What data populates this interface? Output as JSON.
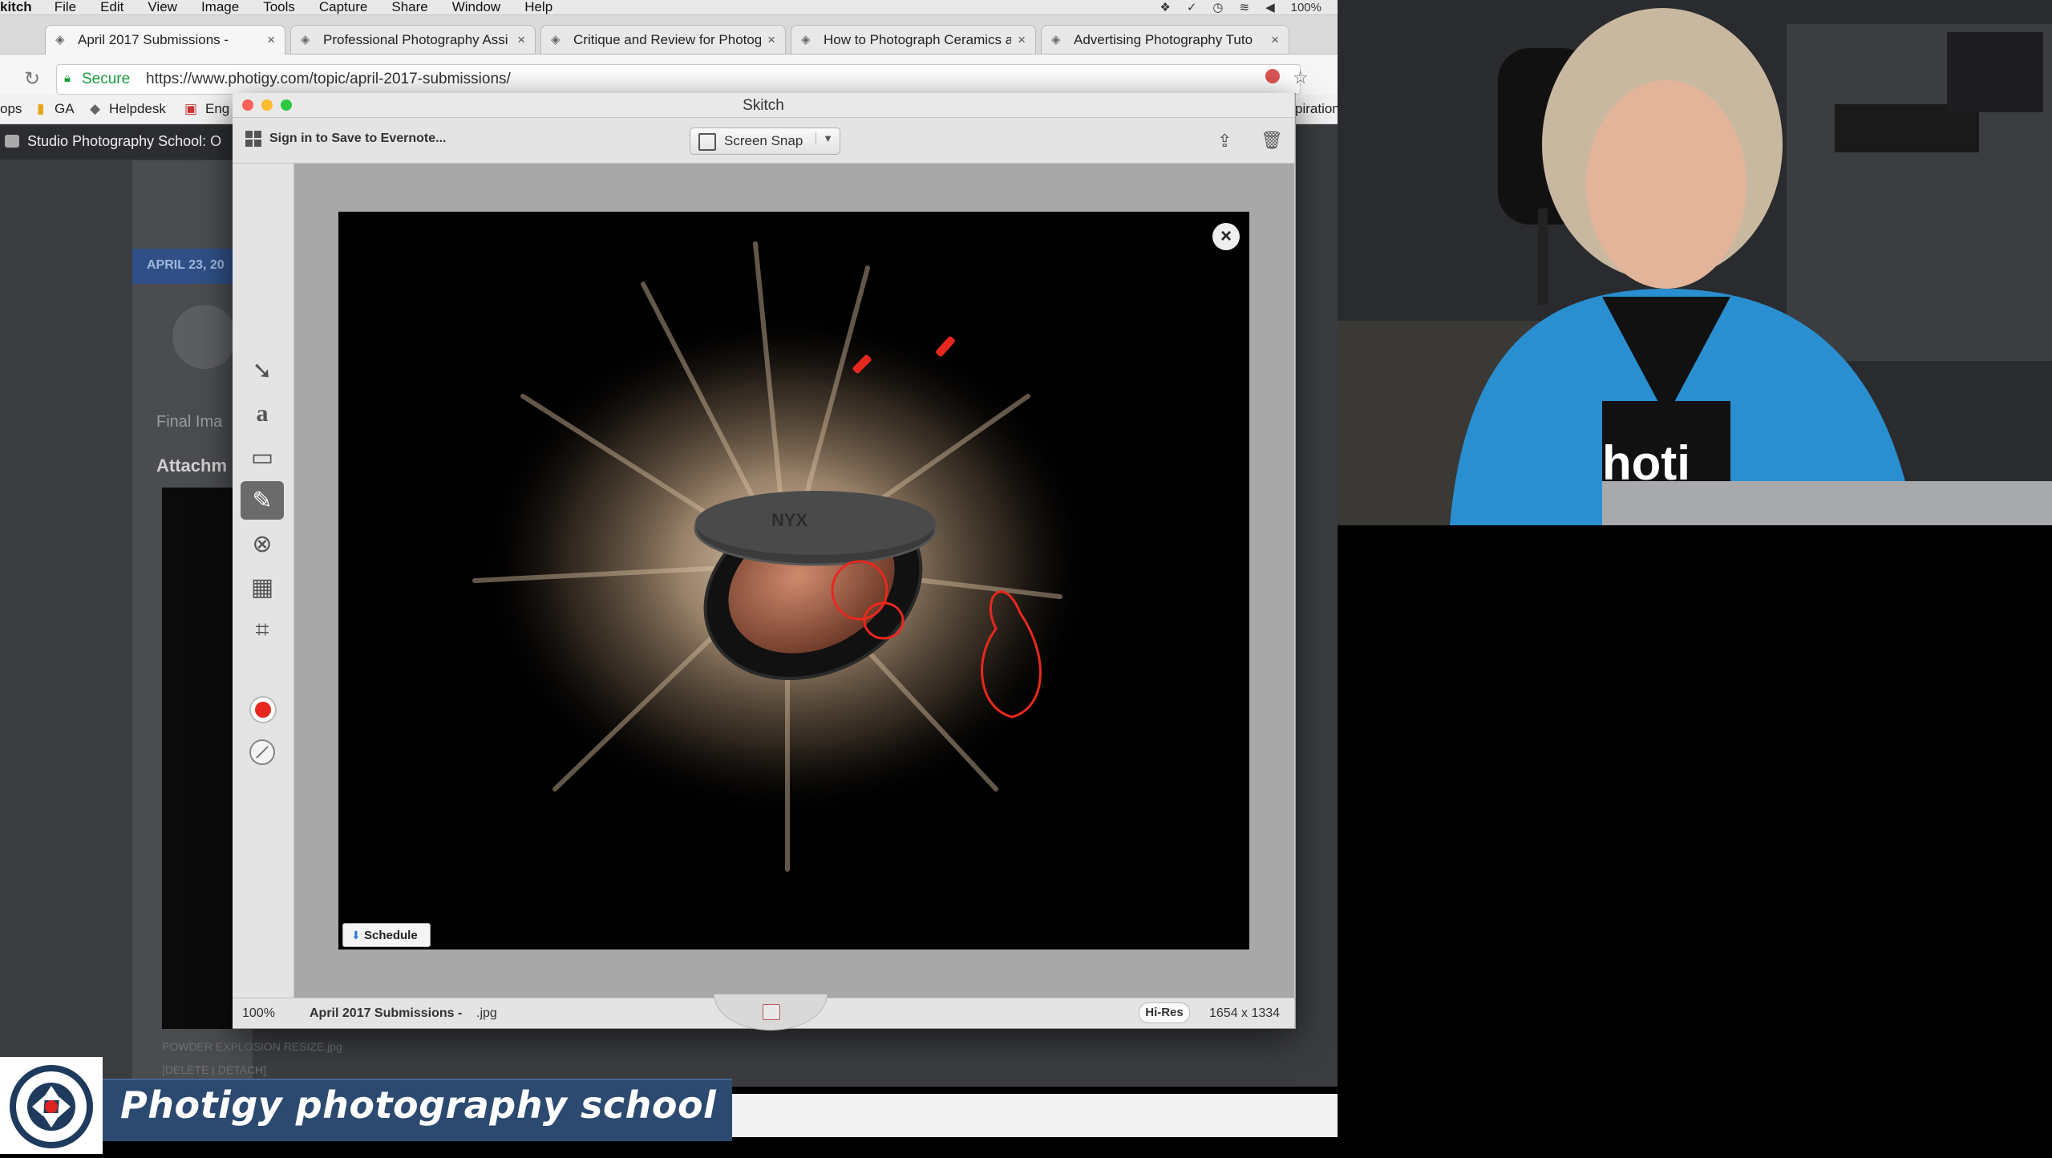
{
  "menubar": {
    "app": "kitch",
    "items": [
      "File",
      "Edit",
      "View",
      "Image",
      "Tools",
      "Capture",
      "Share",
      "Window",
      "Help"
    ],
    "battery": "100%"
  },
  "tabs": [
    {
      "label": "April 2017 Submissions -",
      "active": true
    },
    {
      "label": "Professional Photography Assi"
    },
    {
      "label": "Critique and Review for Photog"
    },
    {
      "label": "How to Photograph Ceramics a"
    },
    {
      "label": "Advertising Photography Tuto"
    }
  ],
  "address": {
    "secure": "Secure",
    "url": "https://www.photigy.com/topic/april-2017-submissions/"
  },
  "bookmarks": [
    "ops",
    "GA",
    "Helpdesk",
    "Eng"
  ],
  "inspiration": "piration",
  "site": {
    "studio_tab": "Studio Photography School: O",
    "date_badge": "APRIL 23, 20",
    "final_image": "Final Ima",
    "attachments": "Attachm",
    "powder": "POWDER EXPLOSION RESIZE.jpg",
    "delete": "[DELETE  |  DETACH]"
  },
  "skitch": {
    "title": "Skitch",
    "signin": "Sign in to Save to Evernote...",
    "screen_snap": "Screen Snap",
    "schedule": "Schedule",
    "zoom": "100%",
    "filename": "April 2017 Submissions -",
    "format": ".jpg",
    "hires": "Hi-Res",
    "dimensions": "1654 x 1334",
    "tools": [
      "arrow-tool",
      "text-tool",
      "rectangle-tool",
      "pen-tool",
      "highlighter-tool",
      "pixelate-tool",
      "crop-tool"
    ],
    "annotation_color": "#e8281e"
  },
  "lower_third": {
    "text": "Photigy photography school"
  }
}
